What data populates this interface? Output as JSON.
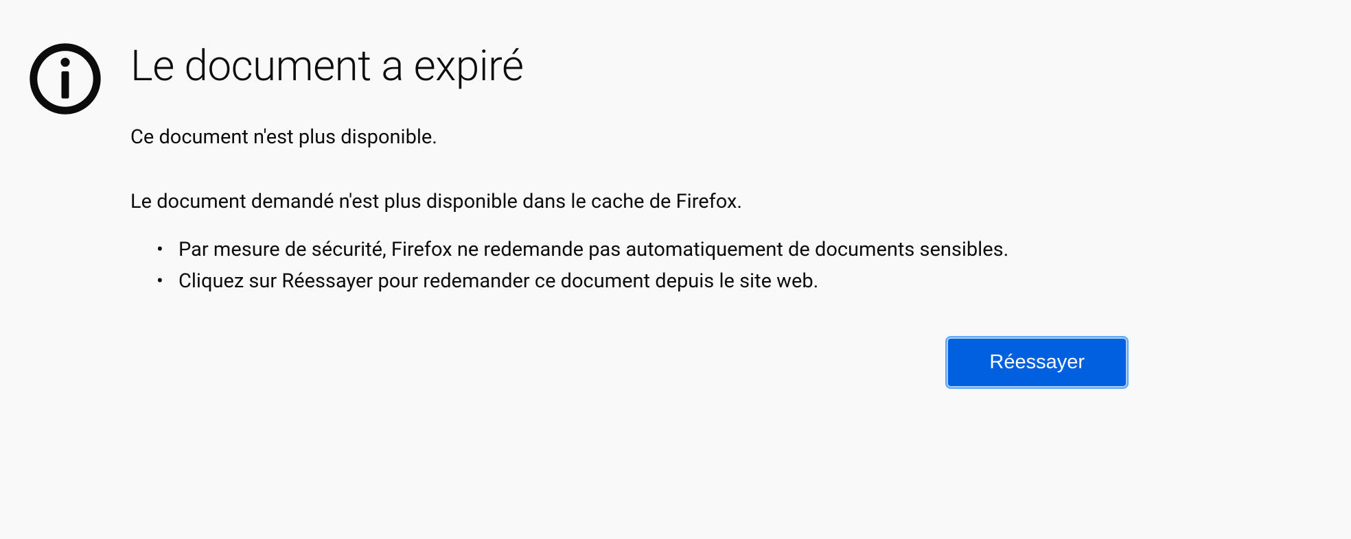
{
  "error": {
    "title": "Le document a expiré",
    "subtitle": "Ce document n'est plus disponible.",
    "description": "Le document demandé n'est plus disponible dans le cache de Firefox.",
    "bullets": [
      "Par mesure de sécurité, Firefox ne redemande pas automatiquement de documents sensibles.",
      "Cliquez sur Réessayer pour redemander ce document depuis le site web."
    ],
    "retry_label": "Réessayer"
  }
}
